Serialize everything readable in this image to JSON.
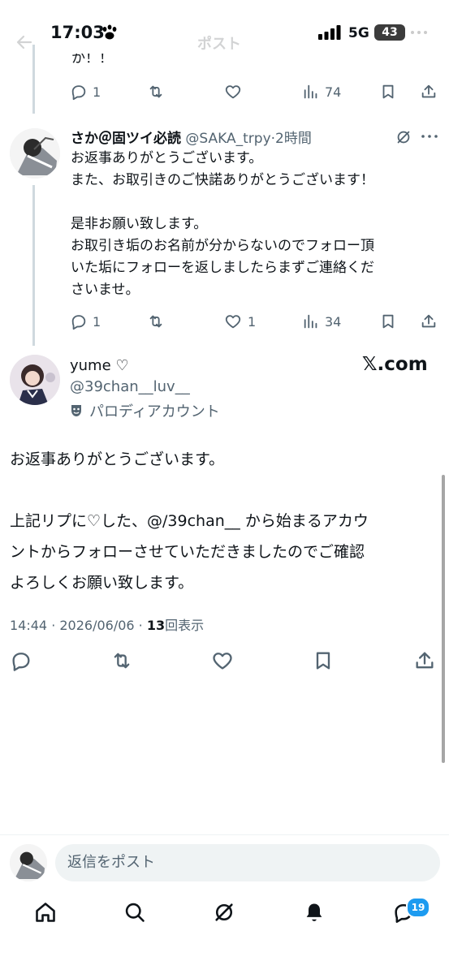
{
  "status_bar": {
    "time": "17:03",
    "network": "5G",
    "battery": "43"
  },
  "top_nav": {
    "title": "ポスト"
  },
  "clipped_post": {
    "text_fragment": "か！！",
    "replies": "1",
    "views": "74"
  },
  "reply_post": {
    "display_name": "さか＠固ツイ必読",
    "handle": "@SAKA_trpy",
    "time_ago": "2時間",
    "text": "お返事ありがとうございます。\nまた、お取引きのご快諾ありがとうございます！\n\n是非お願い致します。\nお取引き垢のお名前が分からないのでフォロー頂\nいた垢にフォローを返しましたらまずご連絡くだ\nさいませ。",
    "replies": "1",
    "likes": "1",
    "views": "34"
  },
  "main_post": {
    "display_name": "yume ♡",
    "handle": "@39chan__luv__",
    "label": "パロディアカウント",
    "brand": "𝕏.com",
    "text": "お返事ありがとうございます。\n\n上記リプに♡した、@/39chan__ から始まるアカウ\nントからフォローさせていただきましたのでご確認\nよろしくお願い致します。",
    "meta_prefix": "14:44 · 2026/06/06 · ",
    "view_count": "13",
    "view_suffix": "回表示"
  },
  "reply_input": {
    "placeholder": "返信をポスト"
  },
  "bottom_nav": {
    "messages_badge": "19"
  },
  "colors": {
    "accent": "#1d9bf0",
    "secondary_text": "#536471",
    "thread_line": "#cfd9de"
  }
}
